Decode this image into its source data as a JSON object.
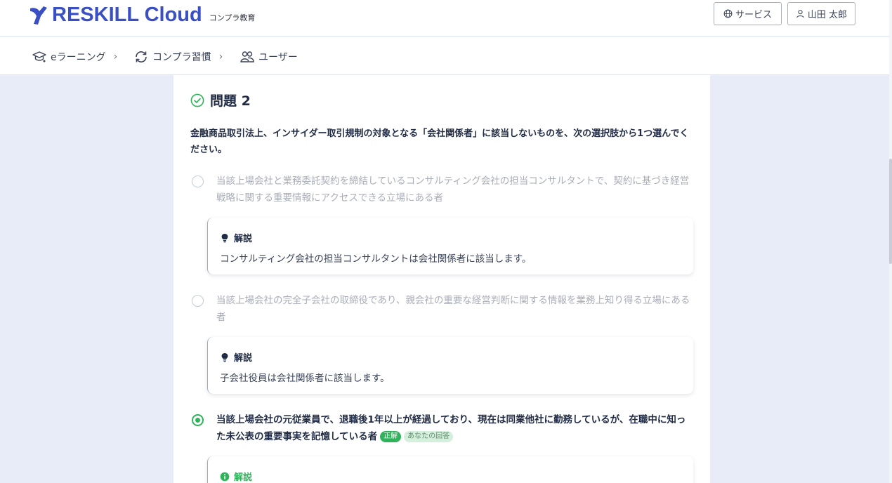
{
  "header": {
    "logo_text": "RESKILL Cloud",
    "logo_sub": "コンプラ教育",
    "service_button": "サービス",
    "user_button": "山田 太郎"
  },
  "nav": {
    "items": [
      {
        "label": "eラーニング",
        "icon": "graduation-cap-icon"
      },
      {
        "label": "コンプラ習慣",
        "icon": "refresh-icon"
      },
      {
        "label": "ユーザー",
        "icon": "users-icon"
      }
    ]
  },
  "question": {
    "title": "問題 2",
    "status_icon": "check-circle-icon",
    "text": "金融商品取引法上、インサイダー取引規制の対象となる「会社関係者」に該当しないものを、次の選択肢から1つ選んでください。",
    "options": [
      {
        "text": "当該上場会社と業務委託契約を締結しているコンサルティング会社の担当コンサルタントで、契約に基づき経営戦略に関する重要情報にアクセスできる立場にある者",
        "selected": false,
        "explanation_title": "解説",
        "explanation_icon": "lightbulb-icon",
        "explanation": "コンサルティング会社の担当コンサルタントは会社関係者に該当します。"
      },
      {
        "text": "当該上場会社の完全子会社の取締役であり、親会社の重要な経営判断に関する情報を業務上知り得る立場にある者",
        "selected": false,
        "explanation_title": "解説",
        "explanation_icon": "lightbulb-icon",
        "explanation": "子会社役員は会社関係者に該当します。"
      },
      {
        "text": "当該上場会社の元従業員で、退職後1年以上が経過しており、現在は同業他社に勤務しているが、在職中に知った未公表の重要事実を記憶している者",
        "selected": true,
        "badge_correct": "正解",
        "badge_answer": "あなたの回答",
        "explanation_title": "解説",
        "explanation_icon": "info-circle-icon"
      }
    ]
  },
  "colors": {
    "brand": "#3b4fc4",
    "correct": "#2fb35a",
    "background": "#e8ebf8"
  }
}
